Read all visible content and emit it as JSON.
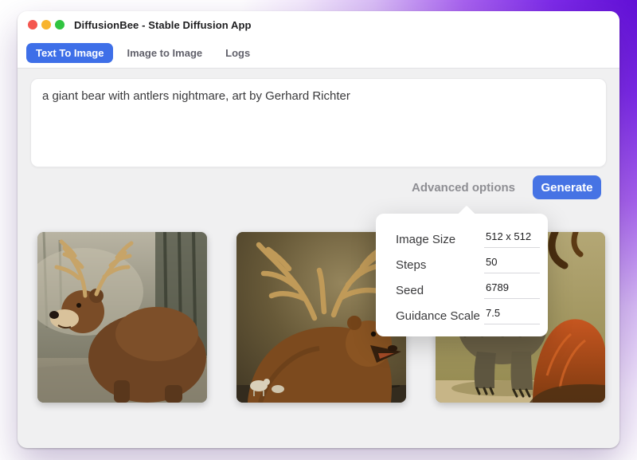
{
  "window": {
    "title": "DiffusionBee - Stable Diffusion App"
  },
  "tabs": [
    {
      "label": "Text To Image",
      "active": true
    },
    {
      "label": "Image to Image",
      "active": false
    },
    {
      "label": "Logs",
      "active": false
    }
  ],
  "prompt": {
    "value": "a giant bear with antlers nightmare, art by Gerhard Richter"
  },
  "actions": {
    "advanced_options": "Advanced options",
    "generate": "Generate"
  },
  "advanced_popover": {
    "fields": [
      {
        "label": "Image Size",
        "value": "512 x 512"
      },
      {
        "label": "Steps",
        "value": "50"
      },
      {
        "label": "Seed",
        "value": "6789"
      },
      {
        "label": "Guidance Scale",
        "value": "7.5"
      }
    ]
  },
  "results": [
    {
      "alt": "Painting of a brown bear with deer antlers in a misty forest"
    },
    {
      "alt": "Painting of a large bear with wide elk antlers, mouth open"
    },
    {
      "alt": "Painting of a shaggy standing bear beside an orange furry creature"
    }
  ],
  "colors": {
    "accent_tab": "#3e6fe8",
    "generate_button": "#4673e4",
    "traffic_close": "#f4564f",
    "traffic_minimize": "#f8b42e",
    "traffic_zoom": "#30c440",
    "background_glow": "#5c0ad2",
    "window_body": "#f0f0f1"
  }
}
